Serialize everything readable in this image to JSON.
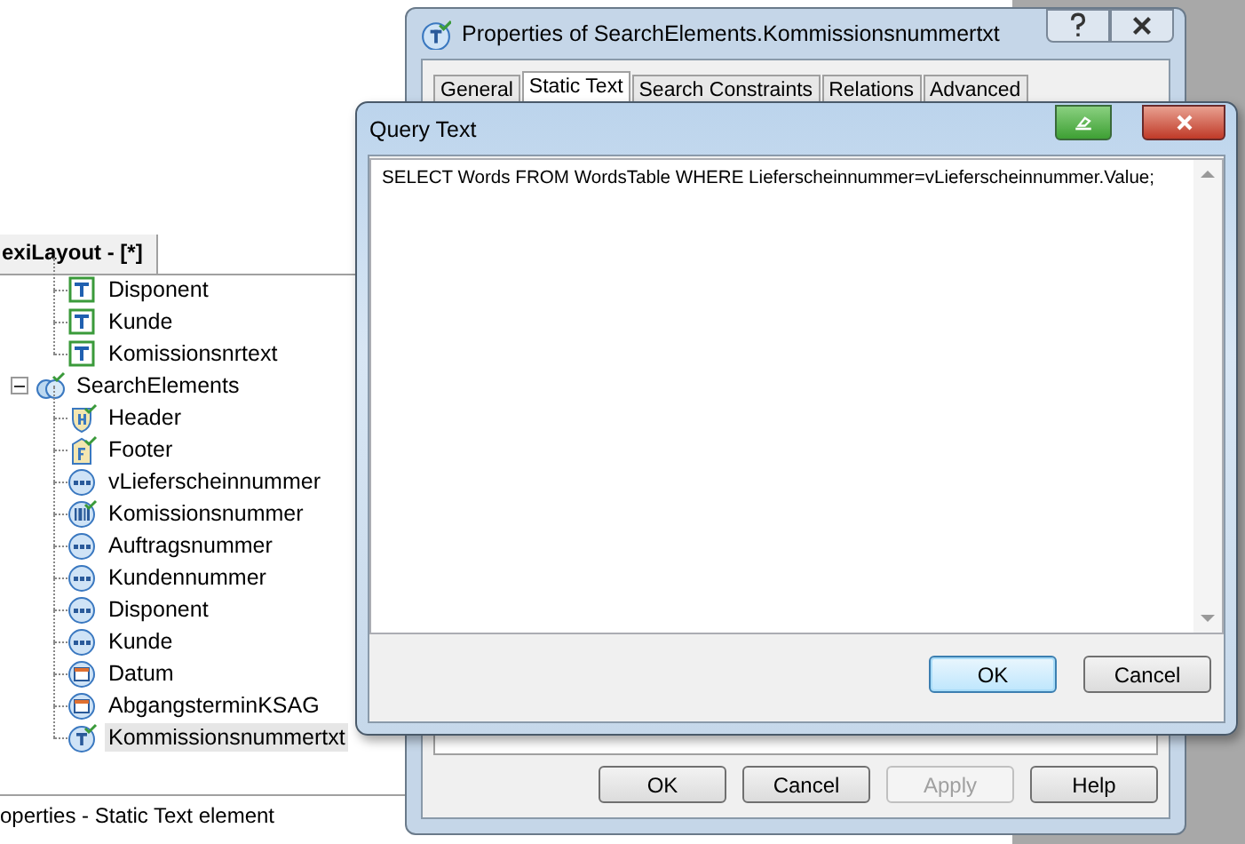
{
  "app_window": {
    "tab": "exiLayout - [*]",
    "tree": {
      "cut_off_children": [
        {
          "label": "Disponent",
          "kind": "text",
          "selected": false
        },
        {
          "label": "Kunde",
          "kind": "text",
          "selected": false
        },
        {
          "label": "Komissionsnrtext",
          "kind": "text",
          "selected": false
        }
      ],
      "nodes": [
        {
          "label": "SearchElements",
          "kind": "group",
          "selected": false,
          "expanded": true,
          "children": [
            {
              "label": "Header",
              "kind": "header",
              "selected": false
            },
            {
              "label": "Footer",
              "kind": "footer",
              "selected": false
            },
            {
              "label": "vLieferscheinnummer",
              "kind": "input",
              "selected": false
            },
            {
              "label": "Komissionsnummer",
              "kind": "barcode",
              "selected": false
            },
            {
              "label": "Auftragsnummer",
              "kind": "input",
              "selected": false
            },
            {
              "label": "Kundennummer",
              "kind": "input",
              "selected": false
            },
            {
              "label": "Disponent",
              "kind": "input",
              "selected": false
            },
            {
              "label": "Kunde",
              "kind": "input",
              "selected": false
            },
            {
              "label": "Datum",
              "kind": "date",
              "selected": false
            },
            {
              "label": "AbgangsterminKSAG",
              "kind": "date",
              "selected": false
            },
            {
              "label": "Kommissionsnummertxt",
              "kind": "static",
              "selected": true
            }
          ]
        }
      ]
    },
    "status_bar": "operties - Static Text element"
  },
  "properties_dialog": {
    "title": "Properties of SearchElements.Kommissionsnummertxt",
    "tabs": [
      {
        "label": "General",
        "selected": false
      },
      {
        "label": "Static Text",
        "selected": true
      },
      {
        "label": "Search Constraints",
        "selected": false
      },
      {
        "label": "Relations",
        "selected": false
      },
      {
        "label": "Advanced",
        "selected": false
      }
    ],
    "buttons": [
      {
        "label": "OK",
        "disabled": false
      },
      {
        "label": "Cancel",
        "disabled": false
      },
      {
        "label": "Apply",
        "disabled": true
      },
      {
        "label": "Help",
        "disabled": false
      }
    ]
  },
  "query_dialog": {
    "title": "Query Text",
    "query": "SELECT Words FROM WordsTable WHERE Lieferscheinnummer=vLieferscheinnummer.Value;",
    "buttons": [
      {
        "label": "OK",
        "default": true
      },
      {
        "label": "Cancel",
        "default": false
      }
    ]
  }
}
